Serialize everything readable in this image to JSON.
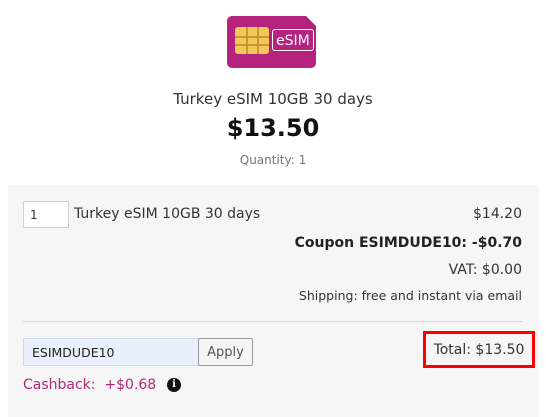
{
  "product": {
    "image_label": "eSIM",
    "title": "Turkey eSIM 10GB 30 days",
    "price": "$13.50",
    "quantity_text": "Quantity: 1"
  },
  "cart": {
    "quantity_value": "1",
    "line_item_name": "Turkey eSIM 10GB 30 days",
    "line_item_price": "$14.20",
    "coupon_line": "Coupon ESIMDUDE10: -$0.70",
    "vat_line": "VAT: $0.00",
    "shipping_line": "Shipping: free and instant via email"
  },
  "coupon": {
    "code_value": "ESIMDUDE10",
    "apply_label": "Apply"
  },
  "total_label": "Total: $13.50",
  "cashback_label": "Cashback:  +$0.68",
  "colors": {
    "brand": "#b5237f",
    "highlight": "#ff0000",
    "cashback": "#b02a7a"
  },
  "icons": {
    "info": "info-icon",
    "sim": "sim-card-icon"
  }
}
